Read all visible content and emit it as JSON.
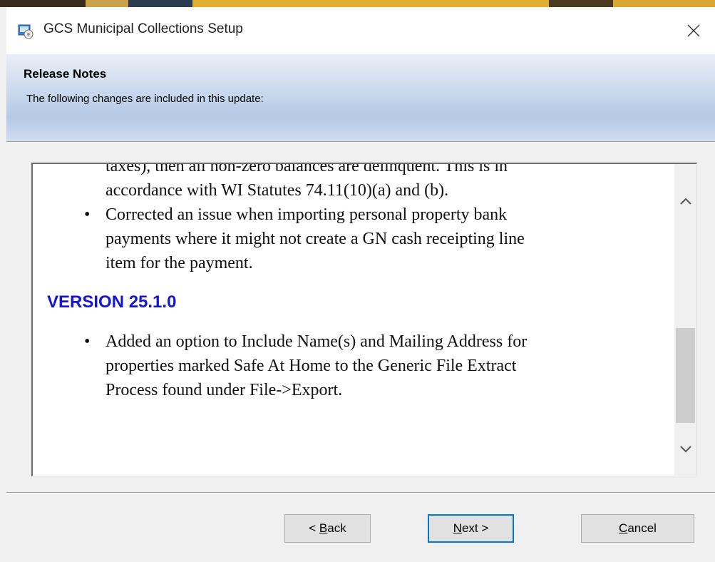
{
  "window": {
    "title": "GCS Municipal Collections Setup",
    "close_glyph": "✕"
  },
  "header": {
    "title": "Release Notes",
    "subtitle": "The following changes are included in this update:"
  },
  "notes": {
    "lines_before": [
      "taxes), then all non-zero balances are delinquent. This is in",
      "accordance with WI Statutes 74.11(10)(a) and (b)."
    ],
    "bullets_before": [
      {
        "lines": [
          "Corrected an issue when importing personal property bank",
          "payments where it might not create a GN cash receipting line",
          "item for the payment."
        ]
      }
    ],
    "version_heading": "VERSION 25.1.0",
    "bullets_after": [
      {
        "lines": [
          "Added an option to Include Name(s) and Mailing Address for",
          "properties marked Safe At Home to the Generic File Extract",
          "Process found under File->Export."
        ]
      }
    ],
    "bullet_glyph": "•",
    "version_color": "#1414d2"
  },
  "buttons": {
    "back": {
      "prefix": "< ",
      "mnemonic": "B",
      "rest": "ack"
    },
    "next": {
      "mnemonic": "N",
      "rest": "ext >"
    },
    "cancel": {
      "mnemonic": "C",
      "rest": "ancel"
    }
  },
  "colors": {
    "accent": "#0078d7",
    "header_gradient_end": "#a9c1e4"
  }
}
